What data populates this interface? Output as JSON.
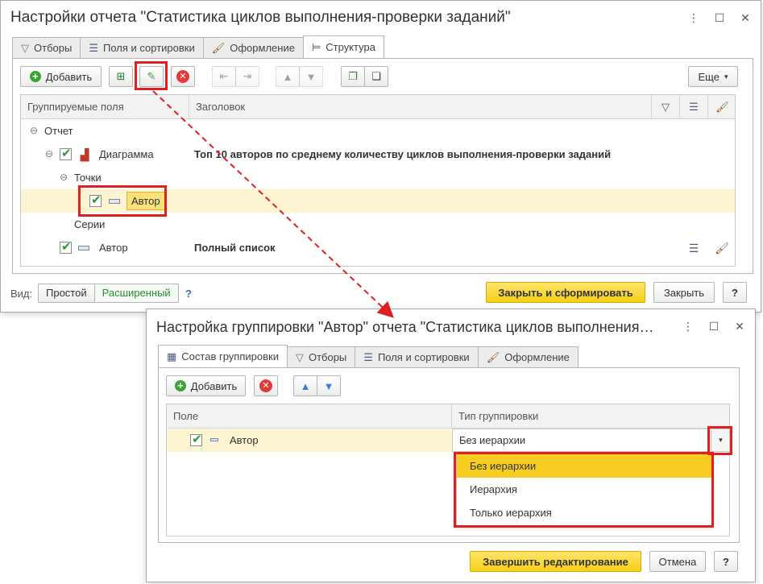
{
  "win1": {
    "title": "Настройки отчета \"Статистика циклов выполнения-проверки заданий\"",
    "tabs": [
      "Отборы",
      "Поля и сортировки",
      "Оформление",
      "Структура"
    ],
    "toolbar": {
      "add": "Добавить",
      "more": "Еще"
    },
    "grid": {
      "col_fields": "Группируемые поля",
      "col_title": "Заголовок",
      "rows": {
        "report": "Отчет",
        "chart": "Диаграмма",
        "chart_title": "Топ 10 авторов по среднему количеству циклов выполнения-проверки заданий",
        "points": "Точки",
        "points_author": "Автор",
        "series": "Серии",
        "author": "Автор",
        "author_title": "Полный список"
      }
    },
    "bottom": {
      "view_label": "Вид:",
      "simple": "Простой",
      "extended": "Расширенный",
      "help": "?",
      "close_build": "Закрыть и сформировать",
      "close": "Закрыть",
      "question": "?"
    }
  },
  "win2": {
    "title": "Настройка группировки \"Автор\" отчета \"Статистика циклов выполнения…",
    "tabs": [
      "Состав группировки",
      "Отборы",
      "Поля и сортировки",
      "Оформление"
    ],
    "toolbar": {
      "add": "Добавить"
    },
    "grid": {
      "col_field": "Поле",
      "col_type": "Тип группировки",
      "row_field": "Автор",
      "row_type": "Без иерархии"
    },
    "dropdown": [
      "Без иерархии",
      "Иерархия",
      "Только иерархия"
    ],
    "bottom": {
      "finish": "Завершить редактирование",
      "cancel": "Отмена",
      "question": "?"
    }
  },
  "colors": {
    "accent_yellow": "#f7cd22",
    "highlight_red": "#e02020",
    "check_green": "#2e9a2e"
  }
}
